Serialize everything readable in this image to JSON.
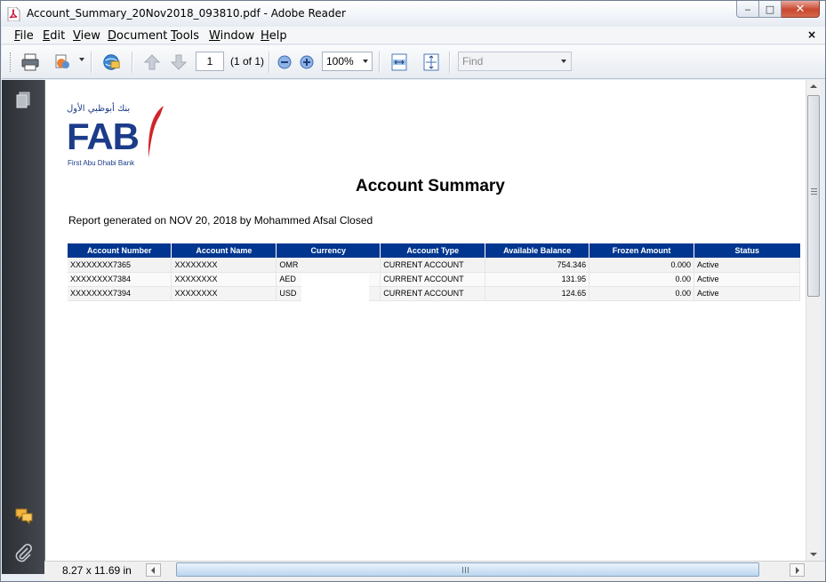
{
  "window": {
    "title": "Account_Summary_20Nov2018_093810.pdf - Adobe Reader",
    "controls": {
      "minimize": "‒",
      "maximize": "□",
      "close": "✕"
    }
  },
  "menu": {
    "items": [
      {
        "key": "F",
        "rest": "ile"
      },
      {
        "key": "E",
        "rest": "dit"
      },
      {
        "key": "V",
        "rest": "iew"
      },
      {
        "key": "D",
        "rest": "ocument"
      },
      {
        "key": "T",
        "rest": "ools"
      },
      {
        "key": "W",
        "rest": "indow"
      },
      {
        "key": "H",
        "rest": "elp"
      }
    ],
    "close_doc": "×"
  },
  "toolbar": {
    "page_number": "1",
    "page_of": "(1 of 1)",
    "zoom": "100%",
    "find_placeholder": "Find",
    "icons": [
      "print-icon",
      "share-icon",
      "collaborate-icon",
      "prev-page-icon",
      "next-page-icon",
      "zoom-out-icon",
      "zoom-in-icon",
      "fit-width-icon",
      "fit-page-icon"
    ]
  },
  "nav_panel": {
    "icons": [
      "pages-icon",
      "comments-icon",
      "attachments-icon"
    ]
  },
  "status": {
    "page_size": "8.27 x 11.69 in"
  },
  "document": {
    "logo": {
      "arabic": "بنك أبوظبي الأول",
      "brand": "FAB",
      "subtitle": "First Abu Dhabi Bank",
      "brand_color": "#1c3c8a",
      "accent_color": "#d2232a"
    },
    "title": "Account Summary",
    "report_line": "Report generated on NOV 20, 2018 by Mohammed Afsal Closed",
    "table": {
      "header_color": "#00368f",
      "columns": [
        "Account Number",
        "Account Name",
        "Currency",
        "Account Type",
        "Available Balance",
        "Frozen Amount",
        "Status"
      ],
      "rows": [
        [
          "XXXXXXXX7365",
          "XXXXXXXX",
          "OMR",
          "CURRENT ACCOUNT",
          "754.346",
          "0.000",
          "Active"
        ],
        [
          "XXXXXXXX7384",
          "XXXXXXXX",
          "AED",
          "CURRENT ACCOUNT",
          "131.95",
          "0.00",
          "Active"
        ],
        [
          "XXXXXXXX7394",
          "XXXXXXXX",
          "USD",
          "CURRENT ACCOUNT",
          "124.65",
          "0.00",
          "Active"
        ]
      ]
    }
  }
}
